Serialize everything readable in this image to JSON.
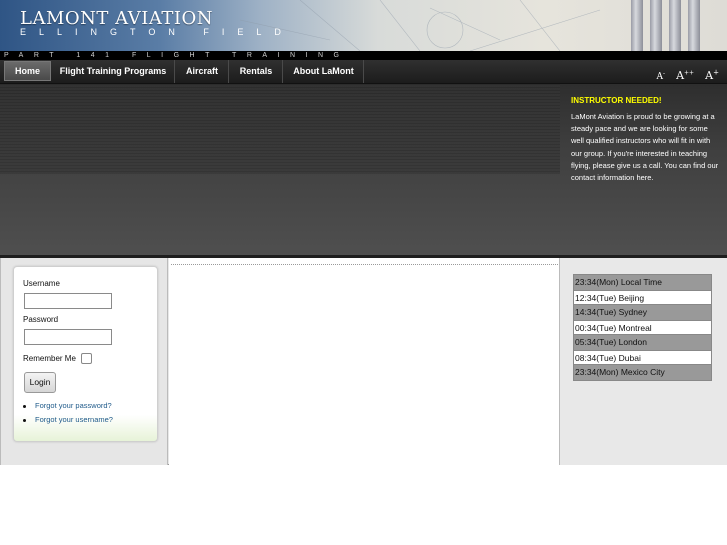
{
  "header": {
    "logo_title": "LAMONT AVIATION",
    "logo_subtitle": "ELLINGTON FIELD",
    "tagline": "PART 141 FLIGHT TRAINING"
  },
  "nav": {
    "items": [
      {
        "label": "Home",
        "active": true
      },
      {
        "label": "Flight Training Programs",
        "active": false
      },
      {
        "label": "Aircraft",
        "active": false
      },
      {
        "label": "Rentals",
        "active": false
      },
      {
        "label": "About LaMont",
        "active": false
      }
    ],
    "font_sizer": {
      "smaller": "A",
      "smaller_mark": "-",
      "reset": "A",
      "reset_mark": "++",
      "larger": "A",
      "larger_mark": "+"
    }
  },
  "notice": {
    "title": "INSTRUCTOR NEEDED!",
    "body": "LaMont Aviation is proud to be growing at a steady pace and we are looking for some well qualified instructors who will fit in with our group.  If you're interested in teaching flying, please give us a call. You can find our contact information here."
  },
  "login": {
    "username_label": "Username",
    "username_value": "",
    "password_label": "Password",
    "password_value": "",
    "remember_label": "Remember Me",
    "remember_checked": false,
    "button_label": "Login",
    "forgot_password": "Forgot your password?",
    "forgot_username": "Forgot your username?"
  },
  "clocks": [
    {
      "text": "23:34(Mon) Local Time",
      "style": "dark"
    },
    {
      "text": "12:34(Tue) Beijing",
      "style": "light"
    },
    {
      "text": "14:34(Tue) Sydney",
      "style": "dark"
    },
    {
      "text": "00:34(Tue) Montreal",
      "style": "light"
    },
    {
      "text": "05:34(Tue) London",
      "style": "dark"
    },
    {
      "text": "08:34(Tue) Dubai",
      "style": "light"
    },
    {
      "text": "23:34(Mon) Mexico City",
      "style": "dark"
    }
  ],
  "colors": {
    "notice_title": "#ffff00",
    "link": "#1f5a8a",
    "nav_bg": "#1c1c1c",
    "clock_dark_row": "#999999"
  },
  "icons": {
    "bullet": "bullet-dot-icon"
  }
}
